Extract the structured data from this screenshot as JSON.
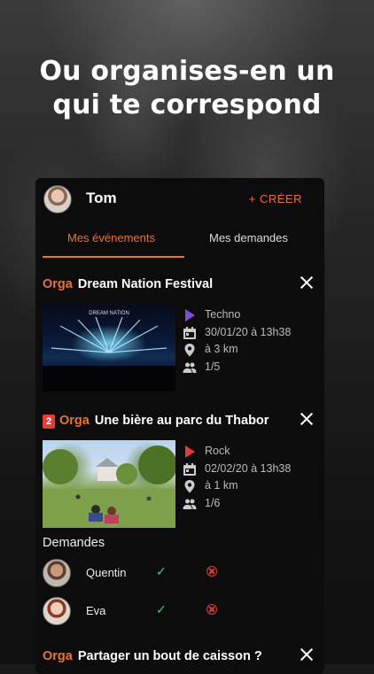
{
  "headline": {
    "line1": "Ou organises-en un",
    "line2": "qui te correspond"
  },
  "header": {
    "username": "Tom",
    "create_label": "+ CRÉER"
  },
  "tabs": [
    {
      "label": "Mes événements",
      "active": true
    },
    {
      "label": "Mes demandes",
      "active": false
    }
  ],
  "events": [
    {
      "orga_label": "Orga",
      "title": "Dream Nation Festival",
      "image": "concert-photo",
      "image_caption": "DREAM NATION",
      "genre": "Techno",
      "genre_color": "#7a4fd6",
      "date": "30/01/20 à 13h38",
      "distance": "à 3 km",
      "participants": "1/5"
    },
    {
      "badge": "2",
      "orga_label": "Orga",
      "title": "Une bière au parc du Thabor",
      "image": "park-photo",
      "genre": "Rock",
      "genre_color": "#e23b3b",
      "date": "02/02/20 à 13h38",
      "distance": "à 1 km",
      "participants": "1/6"
    },
    {
      "orga_label": "Orga",
      "title": "Partager un bout de caisson ?"
    }
  ],
  "requests": {
    "title": "Demandes",
    "items": [
      {
        "name": "Quentin",
        "accept_icon": "check-icon",
        "decline_icon": "decline-icon"
      },
      {
        "name": "Eva",
        "accept_icon": "check-icon",
        "decline_icon": "decline-icon"
      }
    ]
  },
  "colors": {
    "accent": "#e8733a",
    "accept": "#4cc46d",
    "decline": "#e23b3b"
  }
}
